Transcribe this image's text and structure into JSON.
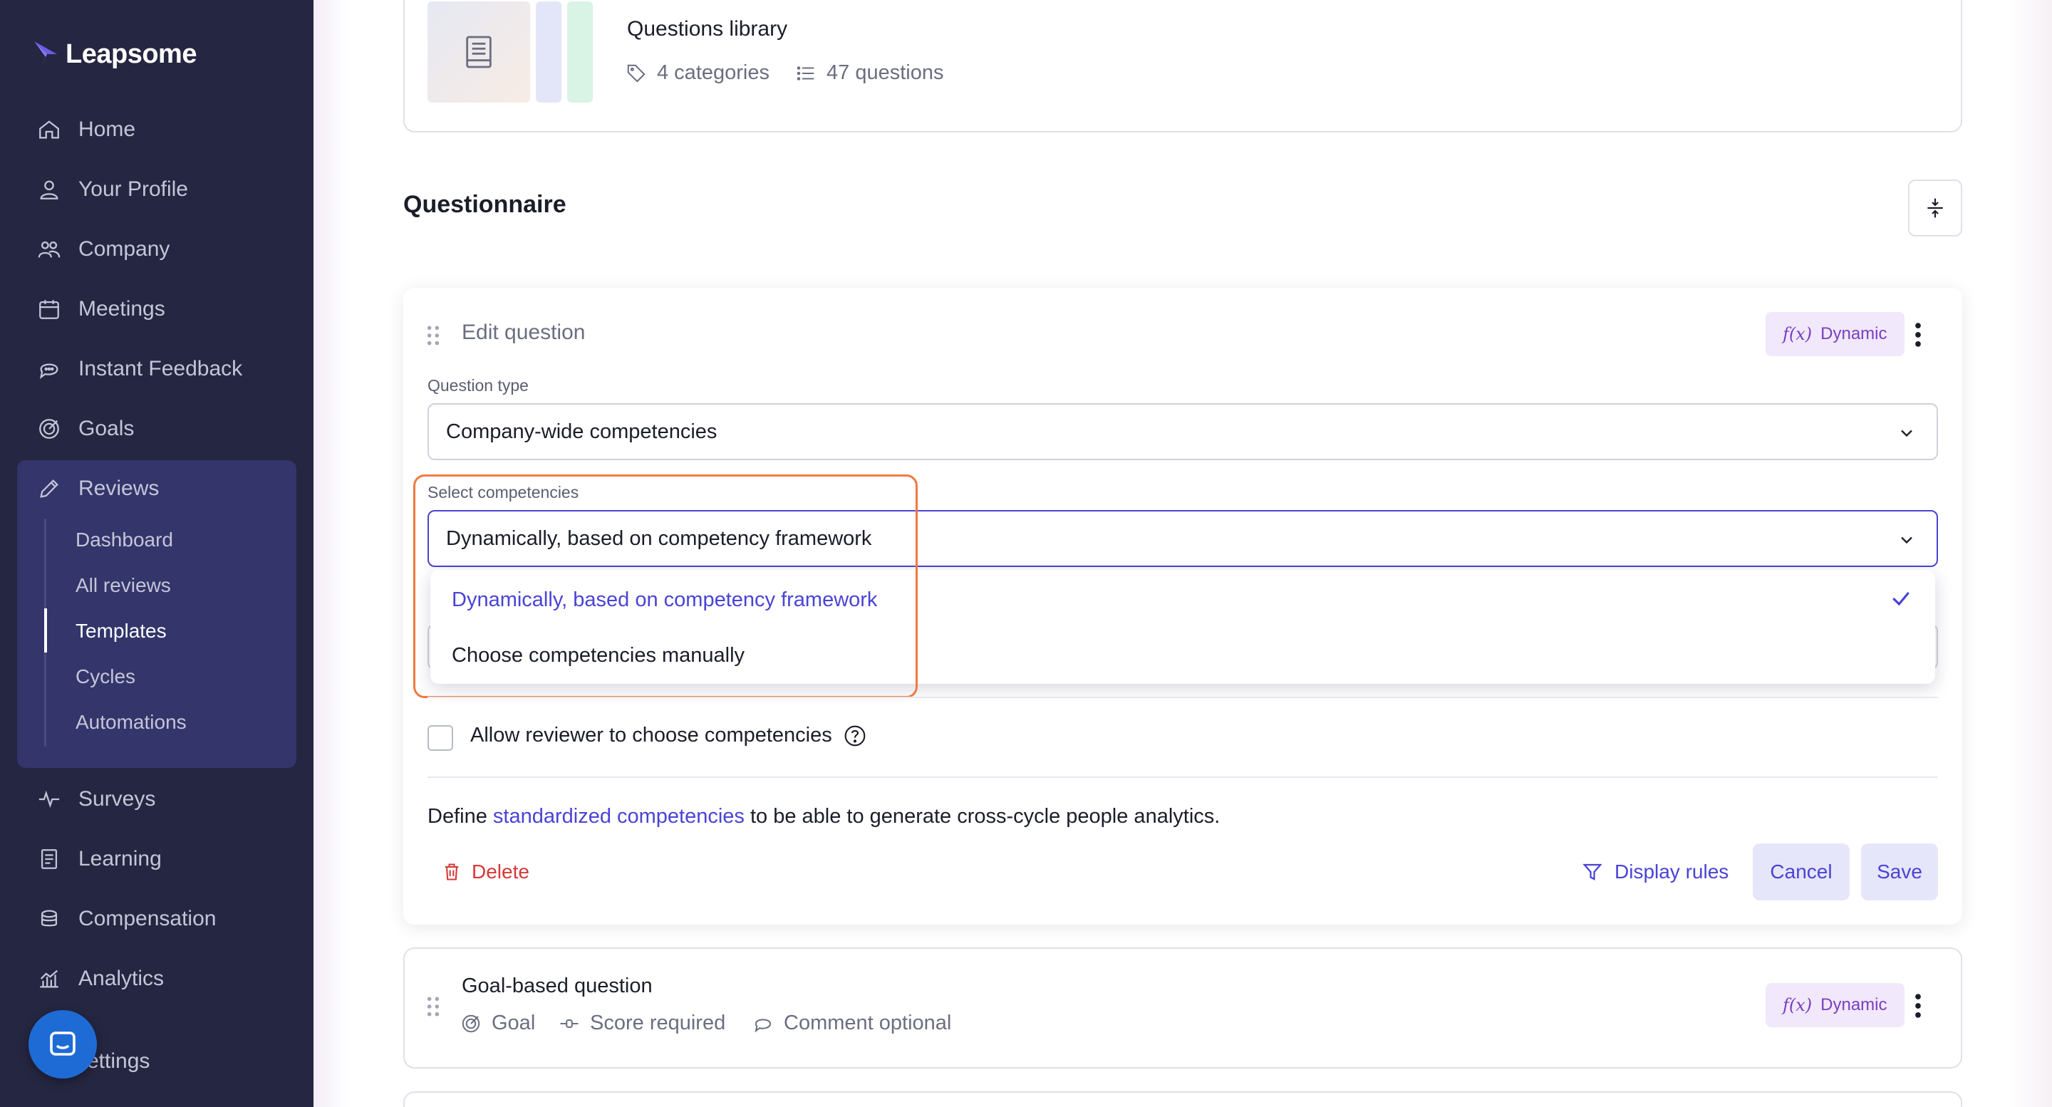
{
  "app": {
    "name": "Leapsome"
  },
  "sidebar": {
    "items": [
      {
        "label": "Home",
        "icon": "home-icon"
      },
      {
        "label": "Your Profile",
        "icon": "user-icon"
      },
      {
        "label": "Company",
        "icon": "people-icon"
      },
      {
        "label": "Meetings",
        "icon": "calendar-icon"
      },
      {
        "label": "Instant Feedback",
        "icon": "chat-icon"
      },
      {
        "label": "Goals",
        "icon": "target-icon"
      },
      {
        "label": "Reviews",
        "icon": "pencil-icon"
      },
      {
        "label": "Surveys",
        "icon": "pulse-icon"
      },
      {
        "label": "Learning",
        "icon": "book-icon"
      },
      {
        "label": "Compensation",
        "icon": "coins-icon"
      },
      {
        "label": "Analytics",
        "icon": "chart-icon"
      },
      {
        "label": "ettings",
        "icon": "gear-icon"
      }
    ],
    "reviews_sub": [
      {
        "label": "Dashboard"
      },
      {
        "label": "All reviews"
      },
      {
        "label": "Templates",
        "active": true
      },
      {
        "label": "Cycles"
      },
      {
        "label": "Automations"
      }
    ]
  },
  "library": {
    "title": "Questions library",
    "categories": "4 categories",
    "questions": "47 questions"
  },
  "questionnaire": {
    "title": "Questionnaire"
  },
  "edit_question": {
    "title": "Edit question",
    "badge": "Dynamic",
    "badge_fx": "f(x)",
    "question_type_label": "Question type",
    "question_type_value": "Company-wide competencies",
    "select_competencies_label": "Select competencies",
    "select_competencies_value": "Dynamically, based on competency framework",
    "options": [
      {
        "label": "Dynamically, based on competency framework",
        "selected": true
      },
      {
        "label": "Choose competencies manually",
        "selected": false
      }
    ],
    "allow_reviewer_label": "Allow reviewer to choose competencies",
    "define_prefix": "Define ",
    "define_link": "standardized competencies",
    "define_suffix": " to be able to generate cross-cycle people analytics.",
    "delete_label": "Delete",
    "display_rules_label": "Display rules",
    "cancel_label": "Cancel",
    "save_label": "Save"
  },
  "goal_question": {
    "title": "Goal-based question",
    "goal": "Goal",
    "score": "Score required",
    "comment": "Comment optional",
    "badge": "Dynamic",
    "badge_fx": "f(x)"
  },
  "colors": {
    "sidebar_bg": "#252641",
    "accent": "#4a43d6",
    "highlight": "#ef7a3f",
    "danger": "#d63838",
    "badge_bg": "#f1e8fb"
  }
}
